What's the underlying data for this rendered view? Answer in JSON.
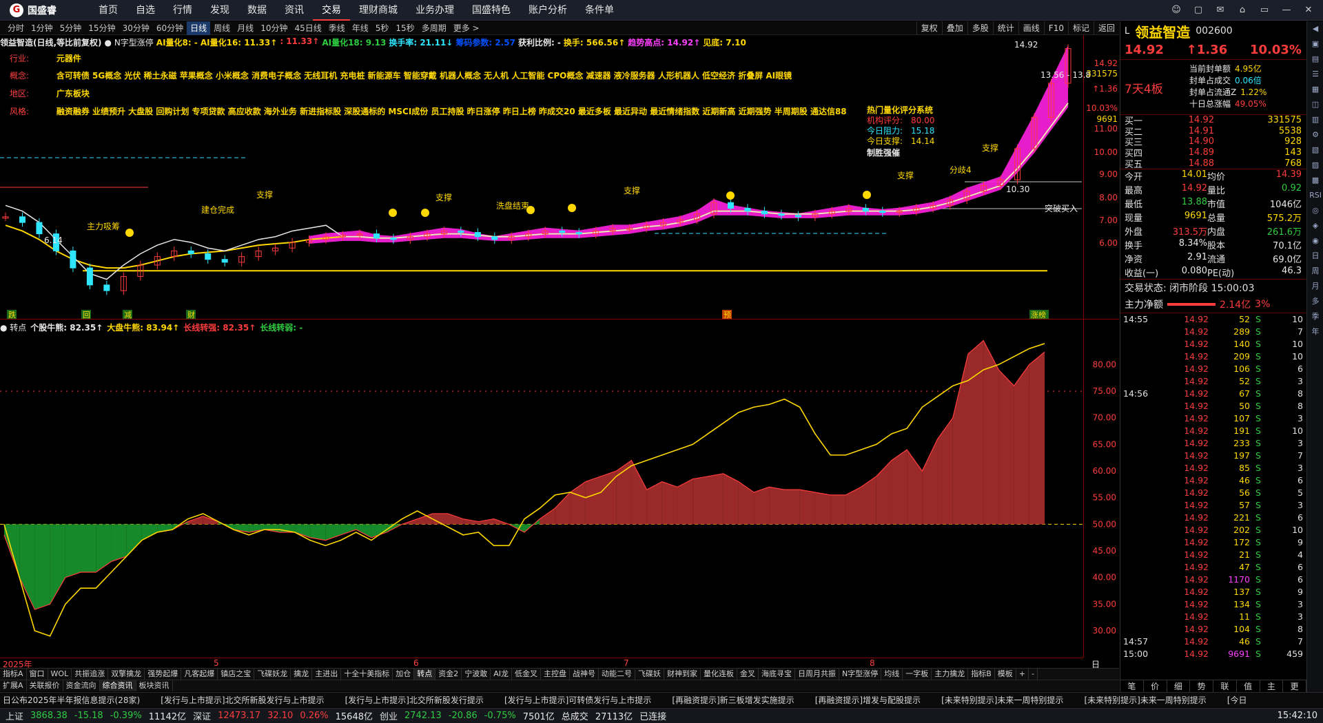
{
  "app": {
    "logo_text": "国盛睿",
    "logo_mark": "G",
    "menu": [
      "首页",
      "自选",
      "行情",
      "发现",
      "数据",
      "资讯",
      "交易",
      "理财商城",
      "业务办理",
      "国盛特色",
      "账户分析",
      "条件单"
    ],
    "active_menu": "交易",
    "window_buttons": [
      "☺",
      "▢",
      "✉",
      "⌂",
      "▭",
      "—",
      "✕"
    ]
  },
  "periods": {
    "items": [
      "分时",
      "1分钟",
      "5分钟",
      "15分钟",
      "30分钟",
      "60分钟",
      "日线",
      "周线",
      "月线",
      "10分钟",
      "45日线",
      "季线",
      "年线",
      "5秒",
      "15秒",
      "多周期",
      "更多 >"
    ],
    "active": "日线",
    "tools": [
      "复权",
      "叠加",
      "多股",
      "统计",
      "画线",
      "F10",
      "标记",
      "返回"
    ]
  },
  "main_indicator": {
    "name": "领益智造(日线,等比前复权)",
    "formula": "● N字型涨停",
    "values": [
      {
        "text": "AI量化8: -",
        "color": "#ffd800"
      },
      {
        "text": "AI量化16: 11.33↑",
        "color": "#ffd800"
      },
      {
        "text": ": 11.33↑",
        "color": "#ff3c3c"
      },
      {
        "text": "AI量化18: 9.13",
        "color": "#2ecc40"
      },
      {
        "text": "换手率: 21.11↓",
        "color": "#2ee6ff"
      },
      {
        "text": "筹码参数: 2.57",
        "color": "#0050ff"
      },
      {
        "text": "获利比例: -",
        "color": "#e8e8e8"
      },
      {
        "text": "换手: 566.56↑",
        "color": "#ffd800"
      },
      {
        "text": "趋势高点: 14.92↑",
        "color": "#ff40ff"
      },
      {
        "text": "见底: 7.10",
        "color": "#ffd800"
      }
    ]
  },
  "stock_info": {
    "industry_label": "行业:",
    "industry": "元器件",
    "concept_label": "概念:",
    "concept": "含可转债 5G概念 光伏 稀土永磁 苹果概念 小米概念 消费电子概念 无线耳机 充电桩 新能源车 智能穿戴 机器人概念 无人机 人工智能 CPO概念 减速器 液冷服务器 人形机器人 低空经济 折叠屏 AI眼镜",
    "region_label": "地区:",
    "region": "广东板块",
    "style_label": "风格:",
    "style": "融资融券 业绩预升 大盘股 回购计划 专项贷款 高应收款 海外业务 新进指标股 深股通标的 MSCI成份 员工持股 昨日涨停 昨日上榜 昨成交20 最近多板 最近异动 最近情绪指数 近期新高 近期强势 半周期股 通达信88"
  },
  "quant_box": {
    "title": "热门量化评分系统",
    "lines": [
      {
        "label": "机构评分:",
        "value": "80.00",
        "color": "#ff3c3c"
      },
      {
        "label": "今日阻力:",
        "value": "15.18",
        "color": "#2ee6ff"
      },
      {
        "label": "今日支撑:",
        "value": "14.14",
        "color": "#ffd800"
      }
    ],
    "footer": "制胜强催"
  },
  "chart_annotations": {
    "support": "支撑",
    "main_buy": "主力吸筹",
    "build_done": "建仓完成",
    "wash_done": "洗盘结束",
    "breakout": "突破买入",
    "divide": "分歧4",
    "high_label": "14.92",
    "low_label": "6.14",
    "band_label": "13.56 - 13.8",
    "level_1030": "10.30",
    "bottom_marks": [
      "跌",
      "回",
      "减",
      "财",
      "预",
      "涨榜"
    ]
  },
  "price_axis": {
    "labels": [
      "14.92",
      "331575",
      "↑1.36",
      "10.03%",
      "9691",
      "11.00",
      "10.00",
      "9.00",
      "8.00",
      "7.00",
      "6.00"
    ]
  },
  "sub_indicator": {
    "name": "● 转点",
    "values": [
      {
        "text": "个股牛熊: 82.35↑",
        "color": "#e8e8e8"
      },
      {
        "text": "大盘牛熊: 83.94↑",
        "color": "#ffd800"
      },
      {
        "text": "长线转强: 82.35↑",
        "color": "#ff3c3c"
      },
      {
        "text": "长线转弱: -",
        "color": "#2ecc40"
      }
    ],
    "yaxis": [
      "80.00",
      "75.00",
      "70.00",
      "65.00",
      "60.00",
      "55.00",
      "50.00",
      "45.00",
      "40.00",
      "35.00",
      "30.00"
    ]
  },
  "xaxis": {
    "labels": [
      "2025年",
      "5",
      "6",
      "7",
      "8"
    ],
    "corner": "日线"
  },
  "chart_data": [
    {
      "type": "line",
      "title": "领益智造(日线,等比前复权)",
      "ylim": [
        5.7,
        15.2
      ],
      "series": [
        {
          "name": "close",
          "values": [
            9.0,
            8.8,
            8.4,
            7.8,
            7.2,
            6.6,
            6.4,
            6.9,
            7.3,
            7.6,
            7.8,
            7.7,
            7.5,
            7.4,
            7.6,
            7.8,
            7.9,
            8.1,
            8.2,
            8.3,
            8.35,
            8.4,
            8.25,
            8.2,
            8.3,
            8.4,
            8.5,
            8.45,
            8.3,
            8.2,
            8.3,
            8.4,
            8.5,
            8.45,
            8.4,
            8.5,
            8.6,
            8.6,
            8.7,
            8.8,
            8.9,
            9.1,
            9.5,
            9.3,
            9.2,
            9.1,
            9.05,
            9.0,
            9.1,
            9.2,
            9.3,
            9.2,
            9.15,
            9.2,
            9.3,
            9.4,
            9.6,
            9.9,
            10.1,
            10.3,
            11.4,
            12.5,
            13.7,
            14.92
          ]
        },
        {
          "name": "ma_short",
          "values": [
            8.7,
            8.5,
            8.2,
            7.8,
            7.5,
            7.3,
            7.2,
            7.2,
            7.3,
            7.45,
            7.6,
            7.7,
            7.75,
            7.8,
            7.9,
            8.0,
            8.05,
            8.1,
            8.2,
            8.25,
            8.3,
            8.3,
            8.25,
            8.25,
            8.3,
            8.35,
            8.4,
            8.4,
            8.35,
            8.3,
            8.3,
            8.35,
            8.4,
            8.4,
            8.4,
            8.45,
            8.5,
            8.55,
            8.65,
            8.7,
            8.8,
            8.95,
            9.2,
            9.2,
            9.2,
            9.15,
            9.1,
            9.1,
            9.1,
            9.15,
            9.2,
            9.2,
            9.2,
            9.2,
            9.25,
            9.35,
            9.5,
            9.7,
            9.9,
            10.1,
            10.7,
            11.4,
            12.2,
            13.0
          ]
        }
      ]
    },
    {
      "type": "area",
      "title": "转点",
      "ylim": [
        26,
        86
      ],
      "series": [
        {
          "name": "个股牛熊",
          "values": [
            48,
            40,
            34,
            35,
            40,
            41,
            41,
            43,
            44,
            47,
            48.5,
            49,
            50.5,
            51.5,
            50.5,
            49,
            48.5,
            49,
            48.5,
            48.5,
            47.5,
            47,
            48,
            49,
            47.5,
            48.5,
            50,
            51,
            52,
            52,
            51,
            50.5,
            51,
            50,
            48.5,
            51,
            53,
            56,
            58,
            59,
            60,
            62,
            56.5,
            58,
            57,
            58.5,
            59,
            59.5,
            58,
            56,
            57,
            56.5,
            56.5,
            56,
            55.5,
            55.5,
            57,
            59,
            62,
            64,
            60,
            66,
            70,
            82,
            84.5,
            79,
            76,
            80,
            82.35
          ]
        },
        {
          "name": "大盘牛熊",
          "values": [
            50,
            40,
            30,
            29,
            35,
            38,
            38,
            41,
            44,
            47,
            48.5,
            49,
            51,
            52,
            50.5,
            49,
            48,
            49,
            49,
            48.5,
            47,
            46,
            47,
            48.5,
            47,
            49,
            51,
            52.5,
            51,
            49.5,
            48,
            48.5,
            46,
            46,
            51,
            53,
            55.5,
            56,
            55,
            56,
            59,
            61,
            62,
            63,
            64,
            65,
            67,
            69,
            71,
            72,
            72.5,
            73.5,
            72,
            67,
            63,
            63,
            64,
            65,
            67,
            68,
            72,
            74,
            76,
            77,
            79,
            80,
            81.5,
            83,
            83.94
          ]
        }
      ]
    }
  ],
  "indicator_tabs": [
    "指标A",
    "窗口",
    "WOL",
    "共振追涨",
    "双擎擒龙",
    "强势起爆",
    "凡客起爆",
    "镇店之宝",
    "飞碟妖龙",
    "擒龙",
    "主进出",
    "十全十美指标",
    "加仓",
    "转点",
    "资金2",
    "宁波敢",
    "AI龙",
    "低金叉",
    "主控盘",
    "战神号",
    "动能二号",
    "飞碟妖",
    "财神到家",
    "量化连板",
    "金叉",
    "海底寻宝",
    "日周月共振",
    "N字型涨停",
    "均线",
    "一字板",
    "主力擒龙",
    "指标B",
    "模板",
    "+",
    "-"
  ],
  "active_indicator_tab": "转点",
  "bottom_tabs": [
    "扩展A",
    "关联报价",
    "资金流向",
    "综合资讯",
    "板块资讯"
  ],
  "news": [
    "日公布2025年半年报信息提示(28家)",
    "[发行与上市提示]北交所新股发行与上市提示",
    "[发行与上市提示]北交所新股发行提示",
    "[发行与上市提示]可转债发行与上市提示",
    "[再融资提示]新三板增发实施提示",
    "[再融资提示]增发与配股提示",
    "[未来特别提示]未来一周特别提示",
    "[未来特别提示]未来一周特别提示",
    "[今日"
  ],
  "status_bar": [
    {
      "name": "上证",
      "price": "3868.38",
      "chg": "-15.18",
      "pct": "-0.39%",
      "amount": "11142亿"
    },
    {
      "name": "深证",
      "price": "12473.17",
      "chg": "32.10",
      "pct": "0.26%",
      "amount": "15648亿"
    },
    {
      "name": "创业",
      "price": "2742.13",
      "chg": "-20.86",
      "pct": "-0.75%",
      "amount": "7501亿"
    }
  ],
  "status_extra": {
    "label": "总成交",
    "value": "27113亿",
    "connected": "已连接",
    "time": "15:42:10"
  },
  "quote": {
    "name": "领益智造",
    "code": "002600",
    "price": "14.92",
    "change": "↑1.36",
    "pct": "10.03%",
    "limit_badge": "7天4板",
    "lock": [
      {
        "label": "当前封单额",
        "value": "4.95亿",
        "color": "#ffd800"
      },
      {
        "label": "封单占成交",
        "value": "0.06倍",
        "color": "#2ee6ff"
      },
      {
        "label": "封单占流通Z",
        "value": "1.22%",
        "color": "#ffd800"
      },
      {
        "label": "十日总涨幅",
        "value": "49.05%",
        "color": "#ff3c3c"
      }
    ],
    "book": [
      {
        "label": "买一",
        "price": "14.92",
        "vol": "331575"
      },
      {
        "label": "买二",
        "price": "14.91",
        "vol": "5538"
      },
      {
        "label": "买三",
        "price": "14.90",
        "vol": "928"
      },
      {
        "label": "买四",
        "price": "14.89",
        "vol": "143"
      },
      {
        "label": "买五",
        "price": "14.88",
        "vol": "768"
      }
    ],
    "stats": [
      [
        "今开",
        "14.01",
        "均价",
        "14.39"
      ],
      [
        "最高",
        "14.92",
        "量比",
        "0.92"
      ],
      [
        "最低",
        "13.88",
        "市值",
        "1046亿"
      ],
      [
        "现量",
        "9691",
        "总量",
        "575.2万"
      ],
      [
        "外盘",
        "313.5万",
        "内盘",
        "261.6万"
      ],
      [
        "换手",
        "8.34%",
        "股本",
        "70.1亿"
      ],
      [
        "净资",
        "2.91",
        "流通",
        "69.0亿"
      ],
      [
        "收益(一)",
        "0.080",
        "PE(动)",
        "46.3"
      ]
    ],
    "trade_state": "交易状态: 闭市阶段 15:00:03",
    "mainflow_label": "主力净额",
    "mainflow_value": "2.14亿",
    "mainflow_pct": "3%",
    "ticks": [
      {
        "t": "14:55",
        "p": "14.92",
        "v": "52",
        "s": "S",
        "n": "10"
      },
      {
        "t": "",
        "p": "14.92",
        "v": "289",
        "s": "S",
        "n": "7"
      },
      {
        "t": "",
        "p": "14.92",
        "v": "140",
        "s": "S",
        "n": "10"
      },
      {
        "t": "",
        "p": "14.92",
        "v": "209",
        "s": "S",
        "n": "10"
      },
      {
        "t": "",
        "p": "14.92",
        "v": "106",
        "s": "S",
        "n": "6"
      },
      {
        "t": "",
        "p": "14.92",
        "v": "52",
        "s": "S",
        "n": "3"
      },
      {
        "t": "14:56",
        "p": "14.92",
        "v": "67",
        "s": "S",
        "n": "8"
      },
      {
        "t": "",
        "p": "14.92",
        "v": "50",
        "s": "S",
        "n": "8"
      },
      {
        "t": "",
        "p": "14.92",
        "v": "107",
        "s": "S",
        "n": "3"
      },
      {
        "t": "",
        "p": "14.92",
        "v": "191",
        "s": "S",
        "n": "10"
      },
      {
        "t": "",
        "p": "14.92",
        "v": "233",
        "s": "S",
        "n": "3"
      },
      {
        "t": "",
        "p": "14.92",
        "v": "197",
        "s": "S",
        "n": "7"
      },
      {
        "t": "",
        "p": "14.92",
        "v": "85",
        "s": "S",
        "n": "3"
      },
      {
        "t": "",
        "p": "14.92",
        "v": "46",
        "s": "S",
        "n": "6"
      },
      {
        "t": "",
        "p": "14.92",
        "v": "56",
        "s": "S",
        "n": "5"
      },
      {
        "t": "",
        "p": "14.92",
        "v": "57",
        "s": "S",
        "n": "3"
      },
      {
        "t": "",
        "p": "14.92",
        "v": "221",
        "s": "S",
        "n": "6"
      },
      {
        "t": "",
        "p": "14.92",
        "v": "202",
        "s": "S",
        "n": "10"
      },
      {
        "t": "",
        "p": "14.92",
        "v": "172",
        "s": "S",
        "n": "9"
      },
      {
        "t": "",
        "p": "14.92",
        "v": "21",
        "s": "S",
        "n": "4"
      },
      {
        "t": "",
        "p": "14.92",
        "v": "47",
        "s": "S",
        "n": "6"
      },
      {
        "t": "",
        "p": "14.92",
        "v": "1170",
        "s": "S",
        "n": "6"
      },
      {
        "t": "",
        "p": "14.92",
        "v": "137",
        "s": "S",
        "n": "9"
      },
      {
        "t": "",
        "p": "14.92",
        "v": "134",
        "s": "S",
        "n": "3"
      },
      {
        "t": "",
        "p": "14.92",
        "v": "11",
        "s": "S",
        "n": "3"
      },
      {
        "t": "",
        "p": "14.92",
        "v": "104",
        "s": "S",
        "n": "8"
      },
      {
        "t": "14:57",
        "p": "14.92",
        "v": "46",
        "s": "S",
        "n": "7"
      },
      {
        "t": "15:00",
        "p": "14.92",
        "v": "9691",
        "s": "S",
        "n": "459"
      }
    ],
    "bottom_buttons": [
      "笔",
      "价",
      "细",
      "势",
      "联",
      "值",
      "主",
      "更"
    ]
  },
  "sidebar": [
    "◀",
    "▣",
    "▤",
    "☰",
    "▦",
    "◫",
    "▥",
    "⚙",
    "▧",
    "▨",
    "▩",
    "RSI",
    "◎",
    "◈",
    "◉",
    "日",
    "周",
    "月",
    "多",
    "季",
    "年"
  ]
}
